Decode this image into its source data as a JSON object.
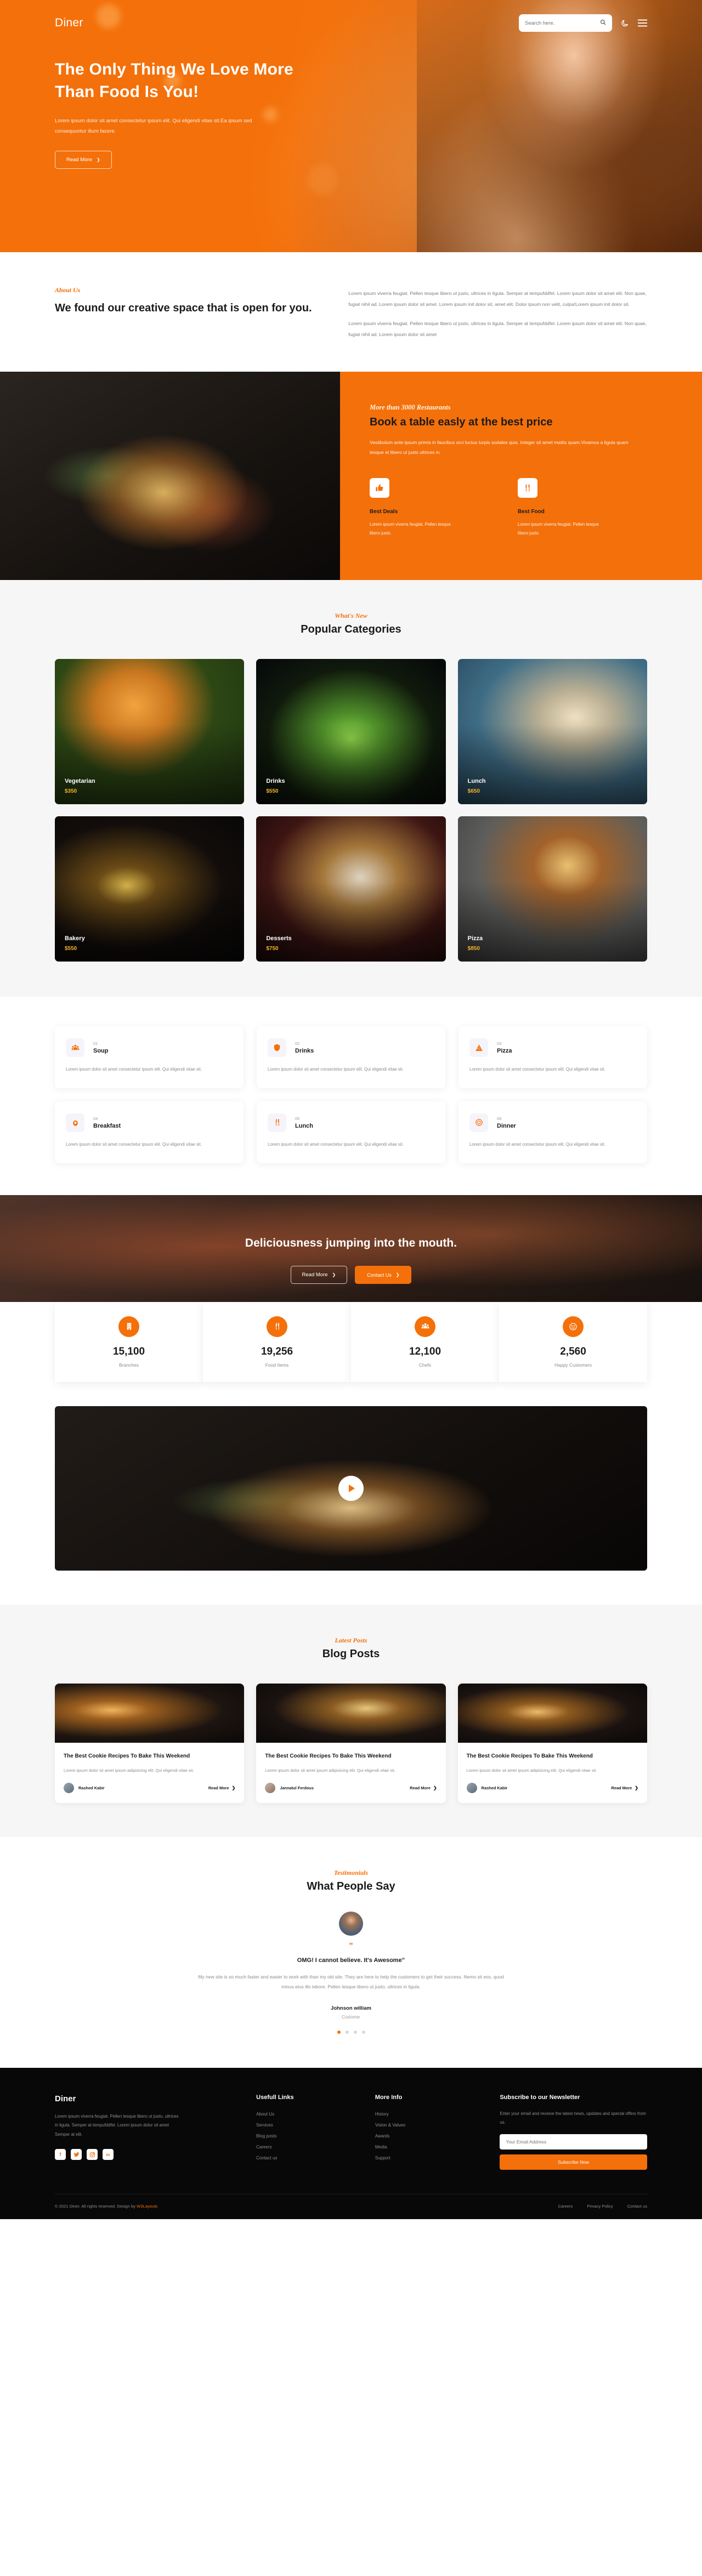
{
  "brand": {
    "name": "Diner",
    "accent": "#f4700a"
  },
  "header": {
    "search_placeholder": "Search here.",
    "search_value": "",
    "search_icon": "search-icon",
    "dark_mode_icon": "moon-icon",
    "menu_icon": "hamburger-menu-icon"
  },
  "hero": {
    "title": "The Only Thing We Love More Than Food Is You!",
    "desc": "Lorem ipsum dolor sit amet consectetur ipsum elit. Qui eligendi vitae sit.Ea ipsum sed consequuntur illum facere.",
    "cta": "Read More"
  },
  "about": {
    "eyebrow": "About Us",
    "title": "We found our creative space that is open for you.",
    "p1": "Lorem ipsum viverra feugiat. Pellen tesque libero ut justo, ultrices in ligula. Semper at tempufddfel. Lorem ipsum dolor sit amet elit. Non quae, fugiat nihil ad. Lorem ipsum dolor sit amet. Lorem ipsum init dolor sit, amet elit. Dolor ipsum non velit, culpa!Lorem ipsum init dolor sit.",
    "p2": "Lorem ipsum viverra feugiat. Pellen tesque libero ut justo, ultrices in ligula. Semper at tempufddfel. Lorem ipsum dolor sit amet elit. Non quae, fugiat nihil ad. Lorem ipsum dolor sit amet"
  },
  "book": {
    "eyebrow": "More than 3000 Restaurants",
    "title": "Book a table easly at the best price",
    "lead": "Vestibulum ante ipsum primis in faucibus orci luctus turpis sodales quis. Integer sit amet mattis quam.Vivamus a ligula quam tesque et libero ut justo ultrices in.",
    "features": [
      {
        "icon": "thumbs-up-icon",
        "glyph": "👍",
        "title": "Best Deals",
        "desc": "Lorem ipsum viverra feugiat. Pellen tesque libero justo."
      },
      {
        "icon": "cutlery-icon",
        "glyph": "🍴",
        "title": "Best Food",
        "desc": "Lorem ipsum viverra feugiat. Pellen tesque libero justo."
      }
    ]
  },
  "categories": {
    "eyebrow": "What's New",
    "title": "Popular Categories",
    "items": [
      {
        "name": "Vegetarian",
        "price": "$350"
      },
      {
        "name": "Drinks",
        "price": "$550"
      },
      {
        "name": "Lunch",
        "price": "$650"
      },
      {
        "name": "Bakery",
        "price": "$550"
      },
      {
        "name": "Desserts",
        "price": "$750"
      },
      {
        "name": "Pizza",
        "price": "$850"
      }
    ]
  },
  "menu_items": [
    {
      "num": "01",
      "name": "Soup",
      "icon": "people-group-icon",
      "glyph": "👥",
      "desc": "Lorem ipsum dolor sit amet consectetur ipsum elit. Qui eligendi vitae sit."
    },
    {
      "num": "02",
      "name": "Drinks",
      "icon": "shield-icon",
      "glyph": "🛡",
      "desc": "Lorem ipsum dolor sit amet consectetur ipsum elit. Qui eligendi vitae sit."
    },
    {
      "num": "03",
      "name": "Pizza",
      "icon": "pizza-slice-icon",
      "glyph": "🍕",
      "desc": "Lorem ipsum dolor sit amet consectetur ipsum elit. Qui eligendi vitae sit."
    },
    {
      "num": "04",
      "name": "Breakfast",
      "icon": "egg-icon",
      "glyph": "🍳",
      "desc": "Lorem ipsum dolor sit amet consectetur ipsum elit. Qui eligendi vitae sit."
    },
    {
      "num": "05",
      "name": "Lunch",
      "icon": "fork-icon",
      "glyph": "🍴",
      "desc": "Lorem ipsum dolor sit amet consectetur ipsum elit. Qui eligendi vitae sit."
    },
    {
      "num": "06",
      "name": "Dinner",
      "icon": "plate-icon",
      "glyph": "🍽",
      "desc": "Lorem ipsum dolor sit amet consectetur ipsum elit. Qui eligendi vitae sit."
    }
  ],
  "cta_banner": {
    "title": "Deliciousness jumping into the mouth.",
    "btn_outline": "Read More",
    "btn_solid": "Contact Us"
  },
  "stats": [
    {
      "icon": "building-icon",
      "glyph": "🏢",
      "value": "15,100",
      "label": "Branches"
    },
    {
      "icon": "cutlery-icon",
      "glyph": "🍴",
      "value": "19,256",
      "label": "Food Items"
    },
    {
      "icon": "chef-icon",
      "glyph": "👥",
      "value": "12,100",
      "label": "Chefs"
    },
    {
      "icon": "smiley-icon",
      "glyph": "☺",
      "value": "2,560",
      "label": "Happy Customers"
    }
  ],
  "video": {
    "play_icon": "play-button-icon"
  },
  "blog": {
    "eyebrow": "Latest Posts",
    "title": "Blog Posts",
    "posts": [
      {
        "title": "The Best Cookie Recipes To Bake This Weekend",
        "excerpt": "Lorem ipsum dolor sit amet ipsum adipisicing elit. Qui eligendi vitae sit.",
        "author": "Rashed Kabir",
        "cta": "Read More"
      },
      {
        "title": "The Best Cookie Recipes To Bake This Weekend",
        "excerpt": "Lorem ipsum dolor sit amet ipsum adipisicing elit. Qui eligendi vitae sit.",
        "author": "Jannatul Ferdous",
        "cta": "Read More"
      },
      {
        "title": "The Best Cookie Recipes To Bake This Weekend",
        "excerpt": "Lorem ipsum dolor sit amet ipsum adipisicing elit. Qui eligendi vitae sit.",
        "author": "Rashed Kabir",
        "cta": "Read More"
      }
    ]
  },
  "testimonial": {
    "eyebrow": "Testimonials",
    "title": "What People Say",
    "quote_mark": "”",
    "headline": "OMG! I cannot believe. It's Awesome”",
    "text": "My new site is so much faster and easier to work with than my old site. They are here to help the customers to get their success. Nemo sit eos, quod minus eius illo labore. Pellen tesque libero ut justo, ultrices in ligula.",
    "name": "Johnson william",
    "role": "Customer",
    "dots": 4,
    "active_dot": 0
  },
  "footer": {
    "brand": "Diner",
    "about": "Lorem ipsum viverra feugiat. Pellen tesque libero ut justo, ultrices in ligula. Semper at tempufddfel. Lorem ipsum dolor sit amet Semper at elit.",
    "socials": [
      {
        "icon": "facebook-icon",
        "glyph": "f"
      },
      {
        "icon": "twitter-icon",
        "glyph": "🐦"
      },
      {
        "icon": "instagram-icon",
        "glyph": "◎"
      },
      {
        "icon": "linkedin-icon",
        "glyph": "in"
      }
    ],
    "col_useful": {
      "title": "Usefull Links",
      "links": [
        "About Us",
        "Services",
        "Blog posts",
        "Careers",
        "Contact us"
      ]
    },
    "col_more": {
      "title": "More Info",
      "links": [
        "History",
        "Vision & Values",
        "Awards",
        "Media",
        "Support"
      ]
    },
    "newsletter": {
      "title": "Subscribe to our Newsletter",
      "desc": "Enter your email and receive the latest news, updates and special offers from us.",
      "placeholder": "Your Email Address",
      "value": "",
      "button": "Subscribe Now"
    },
    "copyright_pre": "© 2021 Diner. All rights reserved. Design by ",
    "copyright_link": "W3Layouts",
    "bottom_links": [
      "Careers",
      "Privacy Policy",
      "Contact us"
    ]
  }
}
